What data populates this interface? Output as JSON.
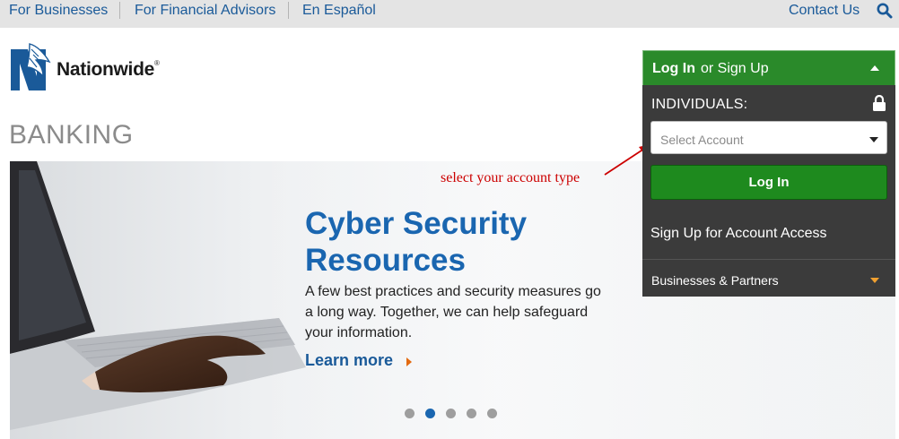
{
  "topbar": {
    "links": [
      "For Businesses",
      "For Financial Advisors",
      "En Español"
    ],
    "contact": "Contact Us",
    "search_icon": "search-icon",
    "background": "#e4e4e4",
    "link_color": "#1a5a99"
  },
  "logo": {
    "name": "Nationwide",
    "registered": "®",
    "icon": "eagle-logo-icon",
    "brand_color": "#1a5a99"
  },
  "page": {
    "title": "BANKING"
  },
  "hero": {
    "headline": "Cyber Security Resources",
    "body": "A few best practices and security measures go a long way. Together, we can help safeguard your information.",
    "cta": "Learn more",
    "carousel": {
      "total": 5,
      "active": 2
    },
    "accent": "#1a66b0"
  },
  "annotation": {
    "text": "select your account type",
    "color": "#cc0000"
  },
  "login": {
    "header_bold": "Log In",
    "header_rest": "or Sign Up",
    "individuals_label": "INDIVIDUALS:",
    "select_placeholder": "Select Account",
    "login_button": "Log In",
    "signup_link": "Sign Up for Account Access",
    "businesses": "Businesses & Partners",
    "header_color": "#2a8a2a",
    "button_color": "#1e8a1e",
    "panel_color": "#3b3b3b"
  }
}
